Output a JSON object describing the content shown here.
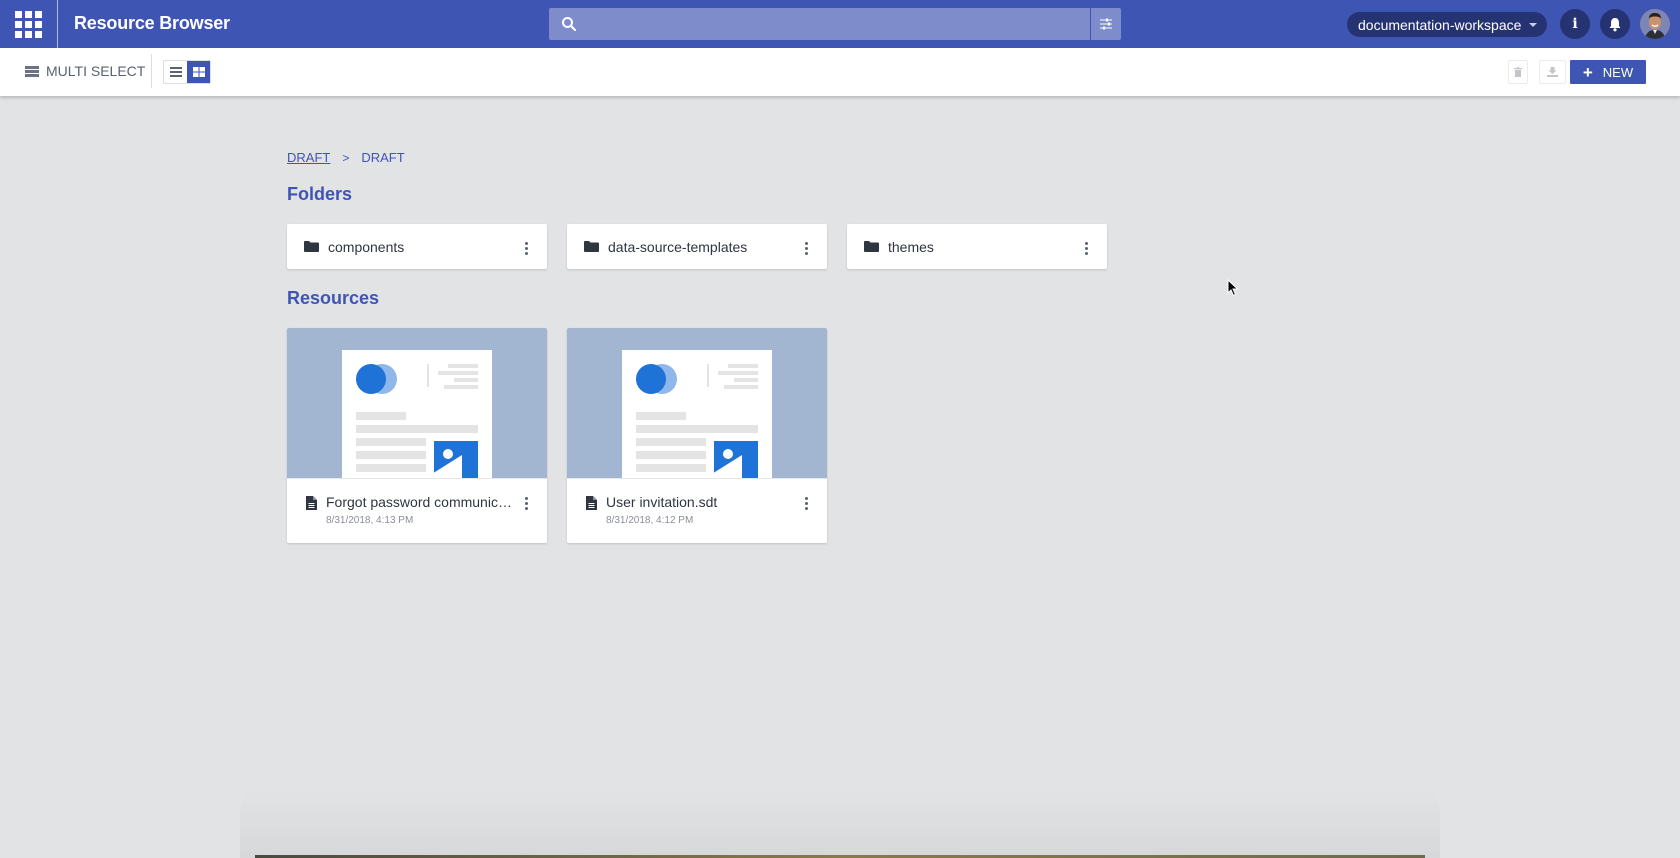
{
  "header": {
    "app_title": "Resource Browser",
    "search": {
      "placeholder": "",
      "value": ""
    },
    "workspace": "documentation-workspace",
    "icons": {
      "apps": "apps-grid-icon",
      "search": "search-icon",
      "filter": "sliders-icon",
      "info": "info-icon",
      "notifications": "bell-icon",
      "avatar": "user-avatar"
    },
    "info_glyph": "i"
  },
  "toolbar": {
    "multi_select_label": "MULTI SELECT",
    "view_modes": [
      {
        "name": "list",
        "active": false
      },
      {
        "name": "grid",
        "active": true
      }
    ],
    "new_label": "NEW",
    "new_glyph": "+"
  },
  "breadcrumb": [
    {
      "label": "DRAFT",
      "link": true
    },
    {
      "label": "DRAFT",
      "link": false
    }
  ],
  "breadcrumb_separator": ">",
  "sections": {
    "folders_title": "Folders",
    "resources_title": "Resources"
  },
  "folders": [
    {
      "name": "components"
    },
    {
      "name": "data-source-templates"
    },
    {
      "name": "themes"
    }
  ],
  "resources": [
    {
      "name": "Forgot password communication.sdt",
      "display_name": "Forgot password communicat...",
      "date": "8/31/2018, 4:13 PM"
    },
    {
      "name": "User invitation.sdt",
      "display_name": "User invitation.sdt",
      "date": "8/31/2018, 4:12 PM"
    }
  ],
  "colors": {
    "brand": "#3f55b3",
    "header_pill": "#263373",
    "background": "#e2e3e5",
    "thumb_background": "#a2b6d2",
    "thumb_accent": "#1f72d6"
  }
}
